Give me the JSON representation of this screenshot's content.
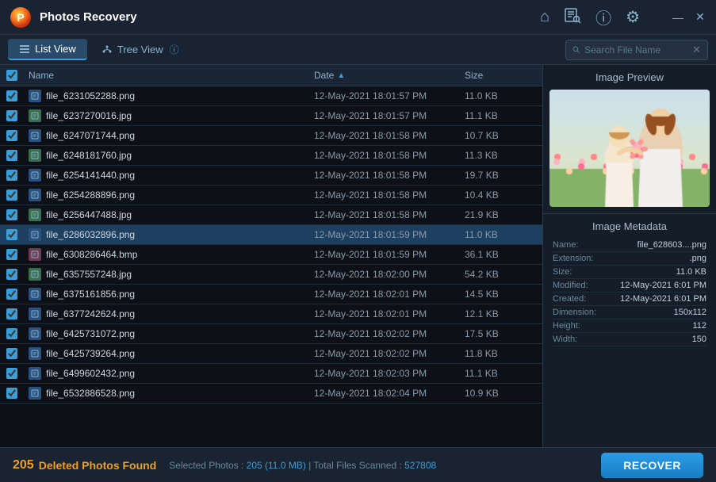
{
  "app": {
    "title": "Photos Recovery",
    "logo_text": "P"
  },
  "titlebar": {
    "home_icon": "⌂",
    "scan_icon": "⊞",
    "info_icon": "ⓘ",
    "settings_icon": "⚙",
    "minimize_icon": "—",
    "close_icon": "✕"
  },
  "toolbar": {
    "list_view_label": "List View",
    "tree_view_label": "Tree View",
    "search_placeholder": "Search File Name"
  },
  "table": {
    "col_name": "Name",
    "col_date": "Date",
    "col_sort_indicator": "▲",
    "col_size": "Size"
  },
  "files": [
    {
      "name": "file_6231052288.png",
      "date": "12-May-2021 18:01:57 PM",
      "size": "11.0 KB",
      "checked": true,
      "selected": false
    },
    {
      "name": "file_6237270016.jpg",
      "date": "12-May-2021 18:01:57 PM",
      "size": "11.1 KB",
      "checked": true,
      "selected": false
    },
    {
      "name": "file_6247071744.png",
      "date": "12-May-2021 18:01:58 PM",
      "size": "10.7 KB",
      "checked": true,
      "selected": false
    },
    {
      "name": "file_6248181760.jpg",
      "date": "12-May-2021 18:01:58 PM",
      "size": "11.3 KB",
      "checked": true,
      "selected": false
    },
    {
      "name": "file_6254141440.png",
      "date": "12-May-2021 18:01:58 PM",
      "size": "19.7 KB",
      "checked": true,
      "selected": false
    },
    {
      "name": "file_6254288896.png",
      "date": "12-May-2021 18:01:58 PM",
      "size": "10.4 KB",
      "checked": true,
      "selected": false
    },
    {
      "name": "file_6256447488.jpg",
      "date": "12-May-2021 18:01:58 PM",
      "size": "21.9 KB",
      "checked": true,
      "selected": false
    },
    {
      "name": "file_6286032896.png",
      "date": "12-May-2021 18:01:59 PM",
      "size": "11.0 KB",
      "checked": true,
      "selected": true
    },
    {
      "name": "file_6308286464.bmp",
      "date": "12-May-2021 18:01:59 PM",
      "size": "36.1 KB",
      "checked": true,
      "selected": false
    },
    {
      "name": "file_6357557248.jpg",
      "date": "12-May-2021 18:02:00 PM",
      "size": "54.2 KB",
      "checked": true,
      "selected": false
    },
    {
      "name": "file_6375161856.png",
      "date": "12-May-2021 18:02:01 PM",
      "size": "14.5 KB",
      "checked": true,
      "selected": false
    },
    {
      "name": "file_6377242624.png",
      "date": "12-May-2021 18:02:01 PM",
      "size": "12.1 KB",
      "checked": true,
      "selected": false
    },
    {
      "name": "file_6425731072.png",
      "date": "12-May-2021 18:02:02 PM",
      "size": "17.5 KB",
      "checked": true,
      "selected": false
    },
    {
      "name": "file_6425739264.png",
      "date": "12-May-2021 18:02:02 PM",
      "size": "11.8 KB",
      "checked": true,
      "selected": false
    },
    {
      "name": "file_6499602432.png",
      "date": "12-May-2021 18:02:03 PM",
      "size": "11.1 KB",
      "checked": true,
      "selected": false
    },
    {
      "name": "file_6532886528.png",
      "date": "12-May-2021 18:02:04 PM",
      "size": "10.9 KB",
      "checked": true,
      "selected": false
    }
  ],
  "preview": {
    "title": "Image Preview",
    "metadata_title": "Image Metadata"
  },
  "metadata": {
    "name_label": "Name:",
    "name_value": "file_628603....png",
    "ext_label": "Extension:",
    "ext_value": ".png",
    "size_label": "Size:",
    "size_value": "11.0 KB",
    "modified_label": "Modified:",
    "modified_value": "12-May-2021 6:01 PM",
    "created_label": "Created:",
    "created_value": "12-May-2021 6:01 PM",
    "dimension_label": "Dimension:",
    "dimension_value": "150x112",
    "height_label": "Height:",
    "height_value": "112",
    "width_label": "Width:",
    "width_value": "150"
  },
  "statusbar": {
    "count": "205",
    "text": "Deleted Photos Found",
    "selected_count": "205",
    "selected_size": "11.0 MB",
    "total_scanned": "527808",
    "detail_prefix": "Selected Photos : ",
    "detail_mid": " | Total Files Scanned : ",
    "recover_label": "RECOVER"
  }
}
